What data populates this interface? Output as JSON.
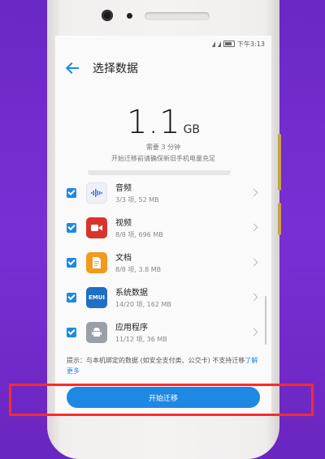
{
  "status_bar": {
    "time": "下午3:13"
  },
  "header": {
    "title": "选择数据"
  },
  "summary": {
    "size_value": "1.1",
    "size_unit": "GB",
    "time_needed": "需要 3 分钟",
    "hint": "开始迁移前请确保新旧手机电量充足"
  },
  "items": [
    {
      "name": "音频",
      "detail": "3/3 项, 52 MB",
      "icon": "audio-icon",
      "checked": true
    },
    {
      "name": "视频",
      "detail": "8/8 项, 696 MB",
      "icon": "video-icon",
      "checked": true
    },
    {
      "name": "文档",
      "detail": "8/8 项, 3.8 MB",
      "icon": "document-icon",
      "checked": true
    },
    {
      "name": "系统数据",
      "detail": "14/20 项, 162 MB",
      "icon": "emui-icon",
      "icon_text": "EMUI",
      "checked": true
    },
    {
      "name": "应用程序",
      "detail": "11/12 项, 36 MB",
      "icon": "android-icon",
      "checked": true
    }
  ],
  "notice": {
    "text": "提示：与本机绑定的数据 (如安全支付类、公交卡) 不支持迁移",
    "link": "了解更多"
  },
  "start_button": {
    "label": "开始迁移"
  },
  "colors": {
    "accent": "#1e88e5",
    "highlight": "#ff2a2a",
    "background": "#7a2fd4"
  }
}
